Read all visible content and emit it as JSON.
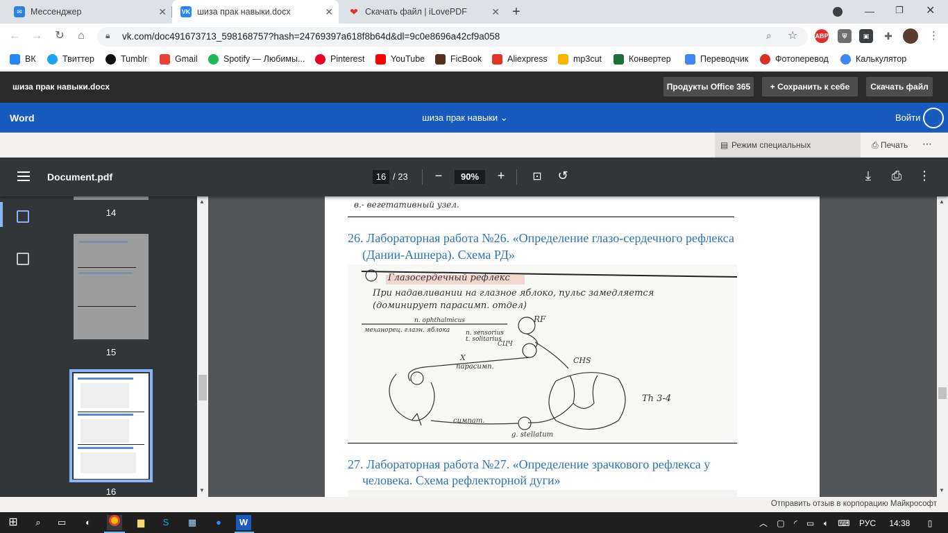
{
  "browser": {
    "tabs": [
      {
        "title": "Мессенджер",
        "icon": "vk-messenger-icon",
        "color": "#2d81e0"
      },
      {
        "title": "шиза прак навыки.docx",
        "icon": "vk-icon",
        "color": "#2787f5"
      },
      {
        "title": "Скачать файл | iLovePDF",
        "icon": "ilovepdf-icon",
        "color": "#e5322d"
      }
    ],
    "url": "vk.com/doc491673713_598168757?hash=24769397a618f8b64d&dl=9c0e8696a42cf9a058",
    "bookmarks": [
      {
        "label": "ВК",
        "color": "#2787f5"
      },
      {
        "label": "Твиттер",
        "color": "#1da1f2"
      },
      {
        "label": "Tumblr",
        "color": "#111111"
      },
      {
        "label": "Gmail",
        "color": "#ea4335"
      },
      {
        "label": "Spotify — Любимы...",
        "color": "#1db954"
      },
      {
        "label": "Pinterest",
        "color": "#e60023"
      },
      {
        "label": "YouTube",
        "color": "#ff0000"
      },
      {
        "label": "FicBook",
        "color": "#5a2d1a"
      },
      {
        "label": "Aliexpress",
        "color": "#e43225"
      },
      {
        "label": "mp3cut",
        "color": "#f7b500"
      },
      {
        "label": "Конвертер",
        "color": "#1f6f3a"
      },
      {
        "label": "Переводчик",
        "color": "#4285f4"
      },
      {
        "label": "Фотоперевод",
        "color": "#d93025"
      },
      {
        "label": "Калькулятор",
        "color": "#4285f4"
      }
    ]
  },
  "vk": {
    "filename": "шиза прак навыки.docx",
    "btn_office": "Продукты Office 365",
    "btn_save": "Сохранить к себе",
    "btn_download": "Скачать файл"
  },
  "word": {
    "app": "Word",
    "doc_title": "шиза прак навыки",
    "signin": "Войти",
    "accessibility": "Режим специальных возможностей",
    "print": "Печать"
  },
  "pdf": {
    "docname": "Document.pdf",
    "page_current": "16",
    "page_total": "/ 23",
    "zoom": "90%",
    "thumb_labels": [
      "14",
      "15",
      "16"
    ],
    "top_snippet": "в.- вегетативный узел.",
    "heading26_line1": "26.    Лабораторная работа №26. «Определение глазо-сердечного рефлекса",
    "heading26_line2": "(Дании-Ашнера). Схема РД»",
    "heading27_line1": "27.    Лабораторная работа №27. «Определение зрачкового рефлекса у",
    "heading27_line2": "человека. Схема рефлекторной дуги»",
    "sketch": {
      "title": "Глазосердечный рефлекс",
      "line1": "При надавливании на глазное яблоко, пульс замедляется",
      "line2": "(доминирует парасимп. отдел)",
      "rf": "RF",
      "ophthalmicus": "n. ophthalmicus",
      "receptors": "механорец. глазн. яблока",
      "sensorius": "n. sensorius",
      "solitarius": "t. solitarius",
      "cns": "СЦЧ",
      "x": "X",
      "parasymp": "парасимп.",
      "sns": "СНЅ",
      "th": "Th 3-4",
      "symp": "симпат.",
      "stellatum": "g. stellatum"
    }
  },
  "feedback": "Отправить отзыв в корпорацию Майкрософт",
  "taskbar": {
    "lang": "РУС",
    "time": "14:38"
  }
}
